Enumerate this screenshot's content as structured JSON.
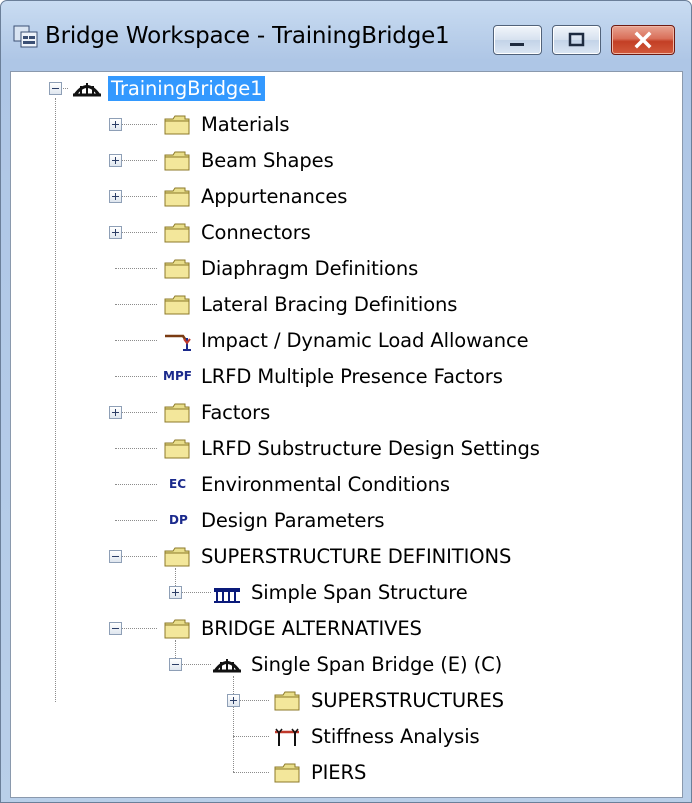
{
  "window": {
    "title": "Bridge Workspace - TrainingBridge1",
    "controls": [
      "minimize",
      "maximize",
      "close"
    ]
  },
  "tree": {
    "root": "TrainingBridge1",
    "nodes": [
      {
        "label": "Materials",
        "icon": "folder-icon",
        "expander": "plus"
      },
      {
        "label": "Beam Shapes",
        "icon": "folder-icon",
        "expander": "plus"
      },
      {
        "label": "Appurtenances",
        "icon": "folder-icon",
        "expander": "plus"
      },
      {
        "label": "Connectors",
        "icon": "folder-icon",
        "expander": "plus"
      },
      {
        "label": "Diaphragm Definitions",
        "icon": "folder-icon",
        "expander": "none"
      },
      {
        "label": "Lateral Bracing Definitions",
        "icon": "folder-icon",
        "expander": "none"
      },
      {
        "label": "Impact / Dynamic Load Allowance",
        "icon": "impact-icon",
        "expander": "none"
      },
      {
        "label": "LRFD Multiple Presence Factors",
        "icon": "mpf-icon",
        "icon_text": "MPF",
        "expander": "none"
      },
      {
        "label": "Factors",
        "icon": "folder-icon",
        "expander": "plus"
      },
      {
        "label": "LRFD Substructure Design Settings",
        "icon": "folder-icon",
        "expander": "none"
      },
      {
        "label": "Environmental Conditions",
        "icon": "ec-icon",
        "icon_text": "EC",
        "expander": "none"
      },
      {
        "label": "Design Parameters",
        "icon": "dp-icon",
        "icon_text": "DP",
        "expander": "none"
      },
      {
        "label": "SUPERSTRUCTURE DEFINITIONS",
        "icon": "folder-icon",
        "expander": "minus"
      },
      {
        "label": "Simple Span Structure",
        "icon": "girder-structure-icon",
        "expander": "plus"
      },
      {
        "label": "BRIDGE ALTERNATIVES",
        "icon": "folder-icon",
        "expander": "minus"
      },
      {
        "label": "Single Span Bridge (E) (C)",
        "icon": "bridge-icon",
        "expander": "minus"
      },
      {
        "label": "SUPERSTRUCTURES",
        "icon": "folder-icon",
        "expander": "plus"
      },
      {
        "label": "Stiffness Analysis",
        "icon": "stiffness-icon",
        "expander": "none"
      },
      {
        "label": "PIERS",
        "icon": "folder-icon",
        "expander": "none"
      }
    ]
  }
}
